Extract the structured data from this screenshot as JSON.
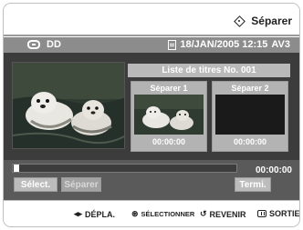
{
  "header": {
    "title": "Séparer",
    "title_icon": "diamond-icon"
  },
  "info": {
    "disc_type": "DD",
    "datetime": "18/JAN/2005 12:15",
    "channel": "AV3"
  },
  "title_list": {
    "heading": "Liste de titres No. 001"
  },
  "split_points": [
    {
      "label": "Séparer 1",
      "time": "00:00:00"
    },
    {
      "label": "Séparer 2",
      "time": "00:00:00"
    }
  ],
  "playback": {
    "time": "00:00:00",
    "progress": 0.0
  },
  "buttons": {
    "select": "Sélect.",
    "split": "Séparer",
    "finish": "Termi."
  },
  "navbar": {
    "move": "DÉPLA.",
    "select": "SÉLECTIONNER",
    "back": "REVENIR",
    "exit": "SORTIE"
  }
}
